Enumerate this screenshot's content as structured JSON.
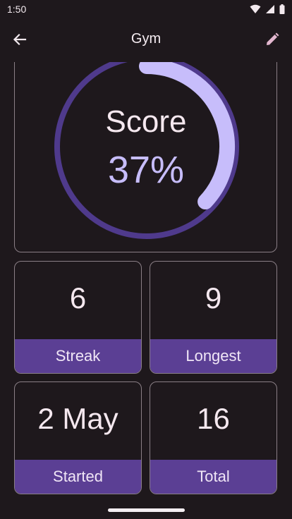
{
  "status_bar": {
    "time": "1:50"
  },
  "app_bar": {
    "title": "Gym",
    "back_icon": "arrow-back-icon",
    "edit_icon": "pencil-icon"
  },
  "score": {
    "label": "Score",
    "value_text": "37%",
    "percent": 37
  },
  "stats": [
    {
      "value": "6",
      "label": "Streak"
    },
    {
      "value": "9",
      "label": "Longest"
    },
    {
      "value": "2 May",
      "label": "Started"
    },
    {
      "value": "16",
      "label": "Total"
    }
  ],
  "colors": {
    "background": "#1e181c",
    "accent": "#c7bdfb",
    "ring_track": "#4f3a8c",
    "footer": "#5b3f94",
    "border": "#8a7f86"
  }
}
